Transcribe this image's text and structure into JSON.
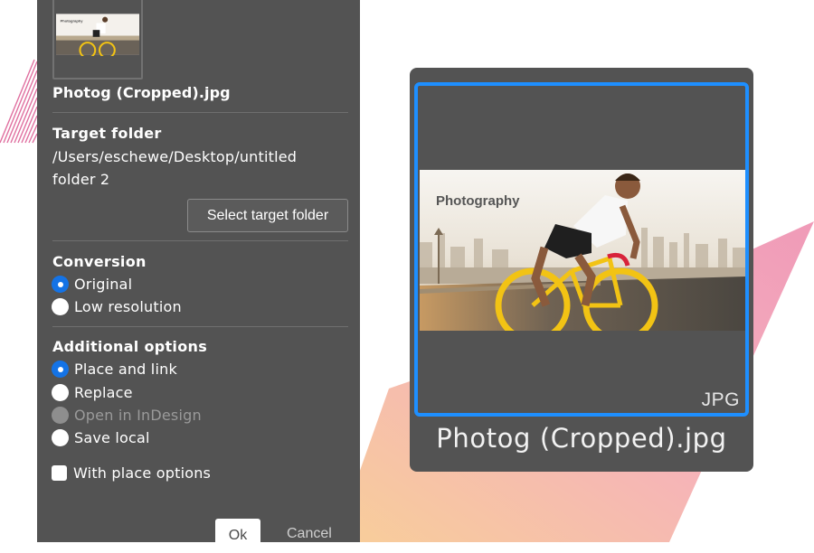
{
  "panel": {
    "file_name": "Photog (Cropped).jpg",
    "target_folder": {
      "heading": "Target folder",
      "path_line1": "/Users/eschewe/Desktop/untitled",
      "path_line2": "folder 2",
      "select_button": "Select target folder"
    },
    "conversion": {
      "heading": "Conversion",
      "options": [
        {
          "label": "Original",
          "selected": true
        },
        {
          "label": "Low resolution",
          "selected": false
        }
      ]
    },
    "additional": {
      "heading": "Additional options",
      "options": [
        {
          "label": "Place and link",
          "selected": true
        },
        {
          "label": "Replace",
          "selected": false
        },
        {
          "label": "Open in InDesign",
          "selected": false,
          "disabled": true
        },
        {
          "label": "Save local",
          "selected": false
        }
      ],
      "checkbox": {
        "label": "With place options",
        "checked": false
      }
    },
    "buttons": {
      "ok": "Ok",
      "cancel": "Cancel"
    }
  },
  "preview": {
    "image_text": "Photography",
    "file_type": "JPG",
    "title": "Photog (Cropped).jpg"
  },
  "colors": {
    "accent": "#1473e6",
    "selection_border": "#1e8fff",
    "panel_bg": "#535353"
  }
}
